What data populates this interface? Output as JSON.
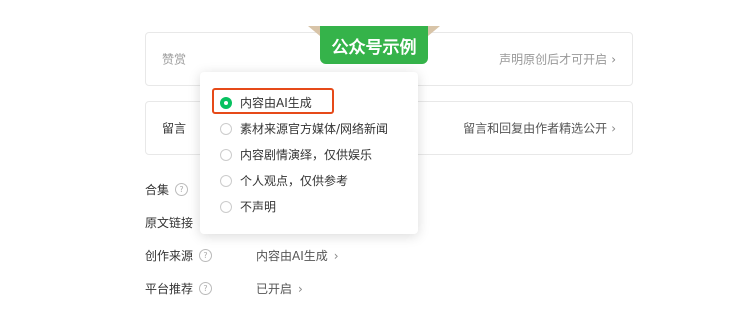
{
  "banner": {
    "text": "公众号示例"
  },
  "reward": {
    "label": "赞赏",
    "action": "声明原创后才可开启"
  },
  "comment": {
    "label": "留言",
    "action": "留言和回复由作者精选公开"
  },
  "rows": {
    "collection": {
      "label": "合集"
    },
    "original_link": {
      "label": "原文链接"
    },
    "source": {
      "label": "创作来源",
      "value": "内容由AI生成"
    },
    "recommend": {
      "label": "平台推荐",
      "value": "已开启"
    }
  },
  "popup": {
    "options": [
      {
        "label": "内容由AI生成",
        "selected": true
      },
      {
        "label": "素材来源官方媒体/网络新闻",
        "selected": false
      },
      {
        "label": "内容剧情演绎，仅供娱乐",
        "selected": false
      },
      {
        "label": "个人观点，仅供参考",
        "selected": false
      },
      {
        "label": "不声明",
        "selected": false
      }
    ]
  },
  "colors": {
    "accent": "#07c160",
    "banner": "#35b34a",
    "highlight": "#e64a19"
  },
  "icons": {
    "help": "question-circle-icon",
    "chevron": "chevron-right-icon"
  }
}
